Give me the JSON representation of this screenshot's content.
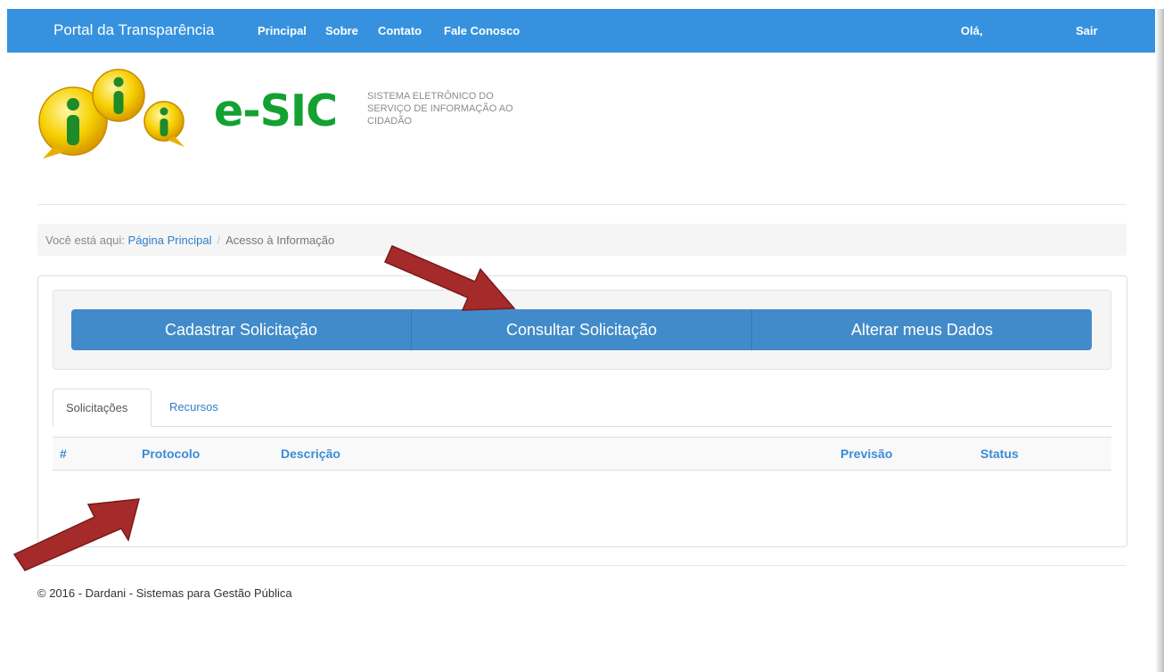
{
  "navbar": {
    "brand": "Portal da Transparência",
    "links": [
      "Principal",
      "Sobre",
      "Contato",
      "Fale Conosco"
    ],
    "greeting": "Olá,",
    "logout": "Sair",
    "color": "#3692de"
  },
  "logo": {
    "title": "e-SIC",
    "subtitle_lines": [
      "SISTEMA ELETRÔNICO DO",
      "SERVIÇO DE INFORMAÇÃO AO",
      "CIDADÃO"
    ],
    "title_color": "#13a131"
  },
  "breadcrumb": {
    "label": "Você está aqui:",
    "home": "Página Principal",
    "separator": "/",
    "current": "Acesso à Informação"
  },
  "actions": [
    "Cadastrar Solicitação",
    "Consultar Solicitação",
    "Alterar meus Dados"
  ],
  "tabs": [
    "Solicitações",
    "Recursos"
  ],
  "table": {
    "headers": [
      "#",
      "Protocolo",
      "Descrição",
      "Previsão",
      "Status"
    ]
  },
  "footer": "© 2016 - Dardani - Sistemas para Gestão Pública",
  "annotations": {
    "arrow_color": "#a52a2a"
  }
}
